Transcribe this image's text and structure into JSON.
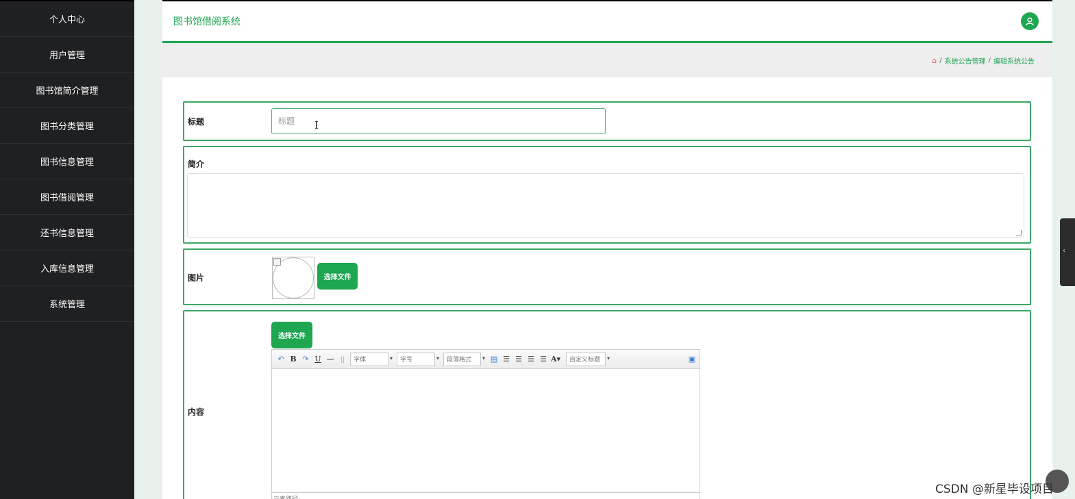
{
  "sidebar": {
    "items": [
      {
        "label": "个人中心"
      },
      {
        "label": "用户管理"
      },
      {
        "label": "图书馆简介管理"
      },
      {
        "label": "图书分类管理"
      },
      {
        "label": "图书信息管理"
      },
      {
        "label": "图书借阅管理"
      },
      {
        "label": "还书信息管理"
      },
      {
        "label": "入库信息管理"
      },
      {
        "label": "系统管理"
      }
    ]
  },
  "header": {
    "title": "图书馆借阅系统",
    "user_icon": "user-icon"
  },
  "breadcrumb": {
    "home_icon": "home-icon",
    "separator": "/",
    "level1": "系统公告管理",
    "level2": "编辑系统公告"
  },
  "form": {
    "title_label": "标题",
    "title_value": "",
    "title_placeholder": "标题",
    "intro_label": "简介",
    "image_label": "图片",
    "image_button": "选择文件",
    "content_label": "内容",
    "content_button": "选择文件"
  },
  "editor": {
    "font_family": "字体",
    "font_size": "字号",
    "paragraph": "段落格式",
    "custom_heading": "自定义标题",
    "status_text": "元素路径:",
    "icons": [
      "undo-icon",
      "bold-icon",
      "redo-icon",
      "underline-icon",
      "horizontal-rule-icon",
      "paste-icon",
      "table-icon",
      "align-left-icon",
      "align-center-icon",
      "align-right-icon",
      "justify-icon",
      "font-color-icon",
      "fullscreen-icon"
    ]
  },
  "watermark": "CSDN @新星毕设项目",
  "colors": {
    "accent": "#1ea651",
    "sidebar_bg": "#1f2022",
    "page_bg": "#e8f1eb"
  }
}
